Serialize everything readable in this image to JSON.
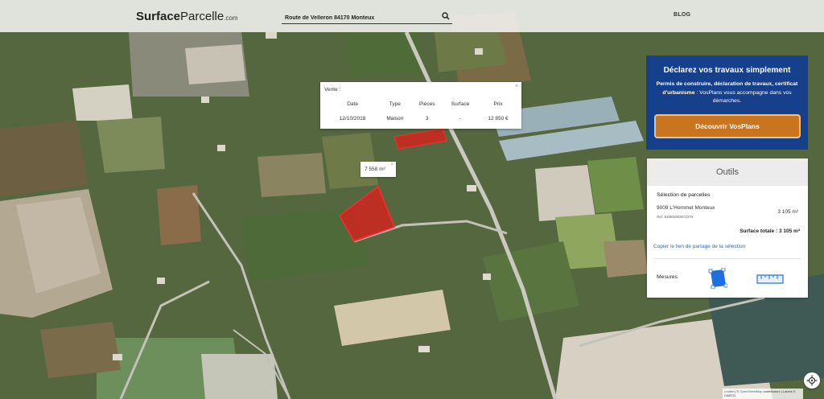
{
  "header": {
    "logo_bold": "Surface",
    "logo_rest": "Parcelle",
    "logo_domain": ".com",
    "search_value": "Route de Velleron 84170 Monteux",
    "blog_label": "BLOG"
  },
  "vente_popup": {
    "title": "Vente :",
    "close": "×",
    "columns": [
      "Date",
      "Type",
      "Pièces",
      "Surface",
      "Prix"
    ],
    "row": [
      "12/10/2018",
      "Maison",
      "3",
      "-",
      "12 850 €"
    ]
  },
  "area_label": {
    "value": "7 558 m²",
    "close": "×"
  },
  "promo": {
    "title": "Déclarez vos travaux simplement",
    "desc_bold": "Permis de construire, déclaration de travaux, certificat d'urbanisme",
    "desc_rest": " : VosPlans vous accompagne dans vos démarches.",
    "button": "Découvrir VosPlans"
  },
  "outils": {
    "header": "Outils",
    "selection_title": "Sélection de parcelles",
    "parcel_name": "9009 L'Hommet Monteux",
    "parcel_ref": "Ref. 840800000C0375",
    "parcel_area": "3 105 m²",
    "total": "Surface totale : 3 105 m²",
    "share_link": "Copier le lien de partage de la sélection",
    "mesures_label": "Mesures"
  },
  "attribution": {
    "leaflet": "Leaflet",
    "sep1": " | © ",
    "osm": "OpenStreetMap",
    "rest": " contributors | Labels © CARTO"
  },
  "colors": {
    "promo_bg": "#163f8c",
    "button_bg": "#c9741e",
    "parcel_fill": "#e01b1b",
    "link": "#2f6fb5"
  },
  "icons": {
    "search": "search-icon",
    "polygon": "polygon-measure-icon",
    "ruler": "ruler-icon",
    "locate": "locate-icon"
  }
}
